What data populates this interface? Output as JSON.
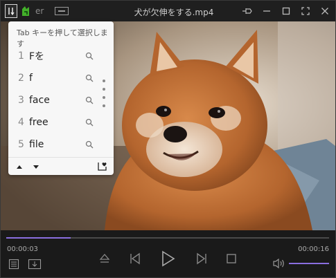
{
  "titlebar": {
    "app_name": "er",
    "title": "犬が欠伸をする.mp4"
  },
  "ime_popup": {
    "header": "Tab キーを押して選択します",
    "candidates": [
      {
        "num": "1",
        "word": "Fを"
      },
      {
        "num": "2",
        "word": "f"
      },
      {
        "num": "3",
        "word": "face"
      },
      {
        "num": "4",
        "word": "free"
      },
      {
        "num": "5",
        "word": "file"
      }
    ]
  },
  "player": {
    "time_current": "00:00:03",
    "time_total": "00:00:16",
    "progress": 0.2,
    "volume": 1.0
  },
  "colors": {
    "accent": "#8a6fe0",
    "popup_bg": "#f7f7f7"
  }
}
